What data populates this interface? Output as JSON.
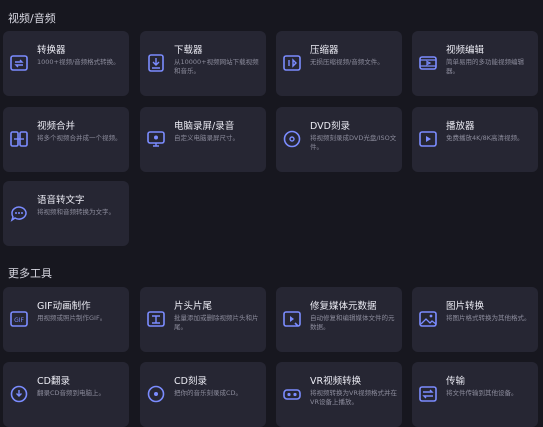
{
  "sections": [
    {
      "title": "视频/音频",
      "cards": [
        {
          "title": "转换器",
          "desc": "1000+视频/音频格式转换。",
          "icon": "convert-icon"
        },
        {
          "title": "下载器",
          "desc": "从10000+视频网站下载视频和音乐。",
          "icon": "download-icon"
        },
        {
          "title": "压缩器",
          "desc": "无损压缩视频/音频文件。",
          "icon": "compress-icon"
        },
        {
          "title": "视频编辑",
          "desc": "简单易用的多功能视频编辑器。",
          "icon": "film-edit-icon"
        },
        {
          "title": "视频合并",
          "desc": "将多个视频合并成一个视频。",
          "icon": "merge-icon"
        },
        {
          "title": "电脑录屏/录音",
          "desc": "自定义电脑录屏尺寸。",
          "icon": "screen-record-icon"
        },
        {
          "title": "DVD刻录",
          "desc": "将视频刻录成DVD光盘/ISO文件。",
          "icon": "dvd-burn-icon"
        },
        {
          "title": "播放器",
          "desc": "免费播放4K/8K高清视频。",
          "icon": "player-icon"
        },
        {
          "title": "语音转文字",
          "desc": "将视频和音频转换为文字。",
          "icon": "speech-to-text-icon"
        }
      ]
    },
    {
      "title": "更多工具",
      "cards": [
        {
          "title": "GIF动画制作",
          "desc": "用视频或照片制作GIF。",
          "icon": "gif-icon"
        },
        {
          "title": "片头片尾",
          "desc": "批量添加或删除视频片头和片尾。",
          "icon": "intro-outro-icon"
        },
        {
          "title": "修复媒体元数据",
          "desc": "自动修复和编辑媒体文件的元数据。",
          "icon": "metadata-icon"
        },
        {
          "title": "图片转换",
          "desc": "将图片格式转换为其他格式。",
          "icon": "image-convert-icon"
        },
        {
          "title": "CD翻录",
          "desc": "翻录CD音频到电脑上。",
          "icon": "cd-rip-icon"
        },
        {
          "title": "CD刻录",
          "desc": "把你的音乐刻录成CD。",
          "icon": "cd-burn-icon"
        },
        {
          "title": "VR视频转换",
          "desc": "将视频转换为VR视频格式并在VR设备上播放。",
          "icon": "vr-icon"
        },
        {
          "title": "传输",
          "desc": "将文件传输到其他设备。",
          "icon": "transfer-icon"
        }
      ]
    }
  ]
}
